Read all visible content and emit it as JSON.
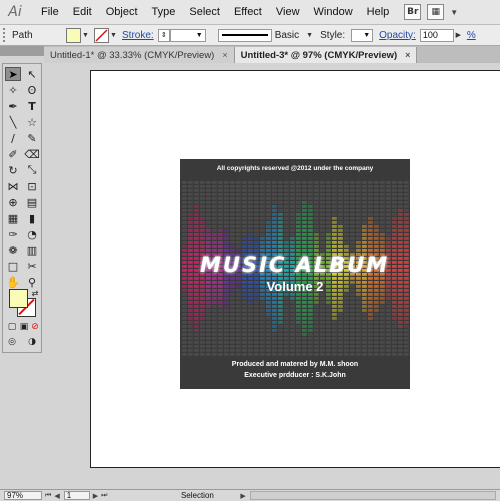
{
  "app": {
    "logo": "Ai"
  },
  "menu": [
    "File",
    "Edit",
    "Object",
    "Type",
    "Select",
    "Effect",
    "View",
    "Window",
    "Help"
  ],
  "menu_icons": [
    {
      "name": "bridge-icon",
      "glyph": "Br"
    },
    {
      "name": "arrange-documents-icon",
      "glyph": "▦"
    }
  ],
  "control_bar": {
    "selection_type": "Path",
    "stroke_label": "Stroke:",
    "stroke_profile": "Basic",
    "style_label": "Style:",
    "opacity_label": "Opacity:",
    "opacity_value": "100"
  },
  "tabs": [
    {
      "label": "Untitled-1* @ 33.33% (CMYK/Preview)",
      "close": "×"
    },
    {
      "label": "Untitled-3* @ 97% (CMYK/Preview)",
      "close": "×",
      "active": true
    }
  ],
  "artwork": {
    "copyright": "All copyrights reserved @2012 under the company",
    "title": "MUSIC ALBUM",
    "subtitle": "Volume 2",
    "credit_producer": "Produced and matered by M.M. shoon",
    "credit_executive": "Executive prdducer : S.K.John",
    "spectrum_colors": [
      "#d0206a",
      "#c02aa0",
      "#7a2fb0",
      "#2c55c8",
      "#1a8fd0",
      "#16b0b0",
      "#20b050",
      "#78c028",
      "#d8d020",
      "#e8a020",
      "#e87020",
      "#d84040"
    ]
  },
  "status_bar": {
    "zoom": "97%",
    "page": "1",
    "status": "Selection"
  },
  "colors": {
    "fill": "#fbfbb8",
    "stroke_none": "#dd1111",
    "link": "#1f48a8",
    "art_bg": "#3a3a3a"
  }
}
